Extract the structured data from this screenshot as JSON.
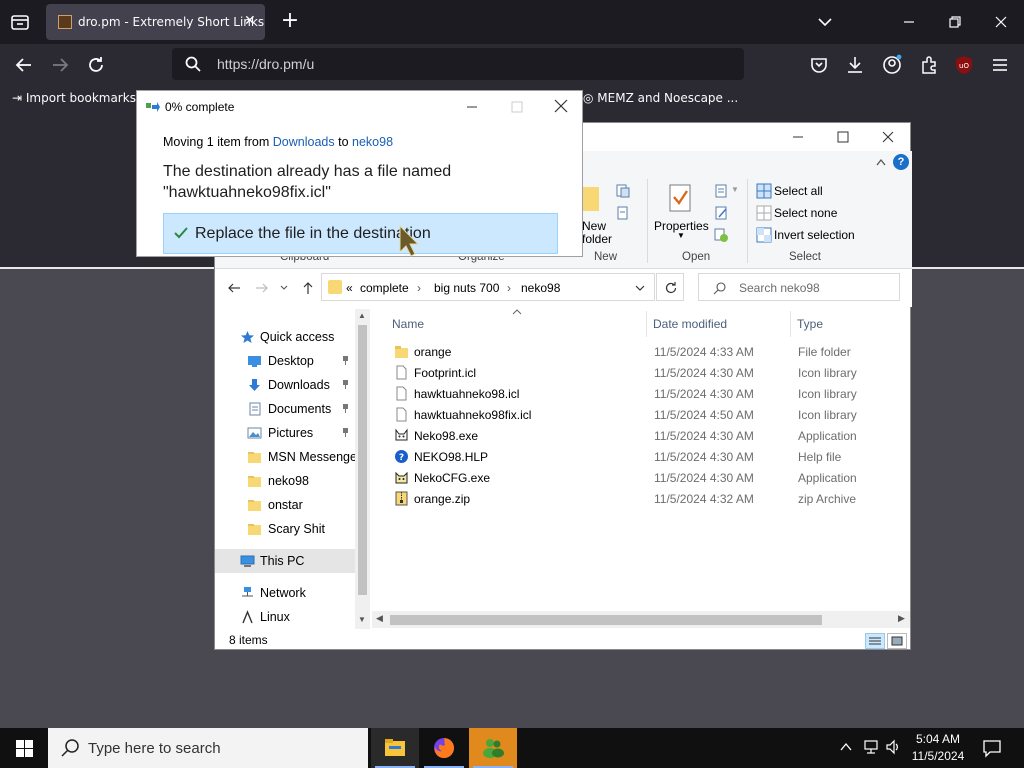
{
  "browser": {
    "tab_title": "dro.pm - Extremely Short Links",
    "url": "https://dro.pm/u",
    "bookmarks": [
      "Import bookmarks...",
      "MEMZ and Noescape ..."
    ]
  },
  "copy_dialog": {
    "title": "0% complete",
    "moving_prefix": "Moving 1 item from",
    "from_link": "Downloads",
    "to_word": "to",
    "to_link": "neko98",
    "message": "The destination already has a file named \"hawktuahneko98fix.icl\"",
    "option_replace": "Replace the file in the destination"
  },
  "explorer": {
    "ribbon": {
      "groups": [
        "Clipboard",
        "Organize",
        "New",
        "Open",
        "Select"
      ],
      "new_folder_partial": [
        "New",
        "folder"
      ],
      "properties": "Properties",
      "select_all": "Select all",
      "select_none": "Select none",
      "invert_selection": "Invert selection"
    },
    "breadcrumb": [
      "«",
      "complete",
      "big nuts 700",
      "neko98"
    ],
    "search_placeholder": "Search neko98",
    "nav": {
      "quick_access": "Quick access",
      "items": [
        "Desktop",
        "Downloads",
        "Documents",
        "Pictures",
        "MSN Messenger",
        "neko98",
        "onstar",
        "Scary Shit"
      ],
      "this_pc": "This PC",
      "network": "Network",
      "linux": "Linux"
    },
    "columns": [
      "Name",
      "Date modified",
      "Type"
    ],
    "files": [
      {
        "name": "orange",
        "date": "11/5/2024 4:33 AM",
        "type": "File folder",
        "icon": "folder-icon"
      },
      {
        "name": "Footprint.icl",
        "date": "11/5/2024 4:30 AM",
        "type": "Icon library",
        "icon": "file-icon"
      },
      {
        "name": "hawktuahneko98.icl",
        "date": "11/5/2024 4:30 AM",
        "type": "Icon library",
        "icon": "file-icon"
      },
      {
        "name": "hawktuahneko98fix.icl",
        "date": "11/5/2024 4:50 AM",
        "type": "Icon library",
        "icon": "file-icon"
      },
      {
        "name": "Neko98.exe",
        "date": "11/5/2024 4:30 AM",
        "type": "Application",
        "icon": "cat-icon"
      },
      {
        "name": "NEKO98.HLP",
        "date": "11/5/2024 4:30 AM",
        "type": "Help file",
        "icon": "help-file-icon"
      },
      {
        "name": "NekoCFG.exe",
        "date": "11/5/2024 4:30 AM",
        "type": "Application",
        "icon": "cat-config-icon"
      },
      {
        "name": "orange.zip",
        "date": "11/5/2024 4:32 AM",
        "type": "zip Archive",
        "icon": "zip-icon"
      }
    ],
    "status": "8 items"
  },
  "taskbar": {
    "search_placeholder": "Type here to search",
    "time": "5:04 AM",
    "date": "11/5/2024"
  },
  "colors": {
    "browser_dark": "#1c1b22",
    "browser_toolbar": "#2b2a33",
    "selection_blue": "#cce8ff",
    "link_blue": "#1a5fb4",
    "folder_yellow": "#f8d775"
  }
}
